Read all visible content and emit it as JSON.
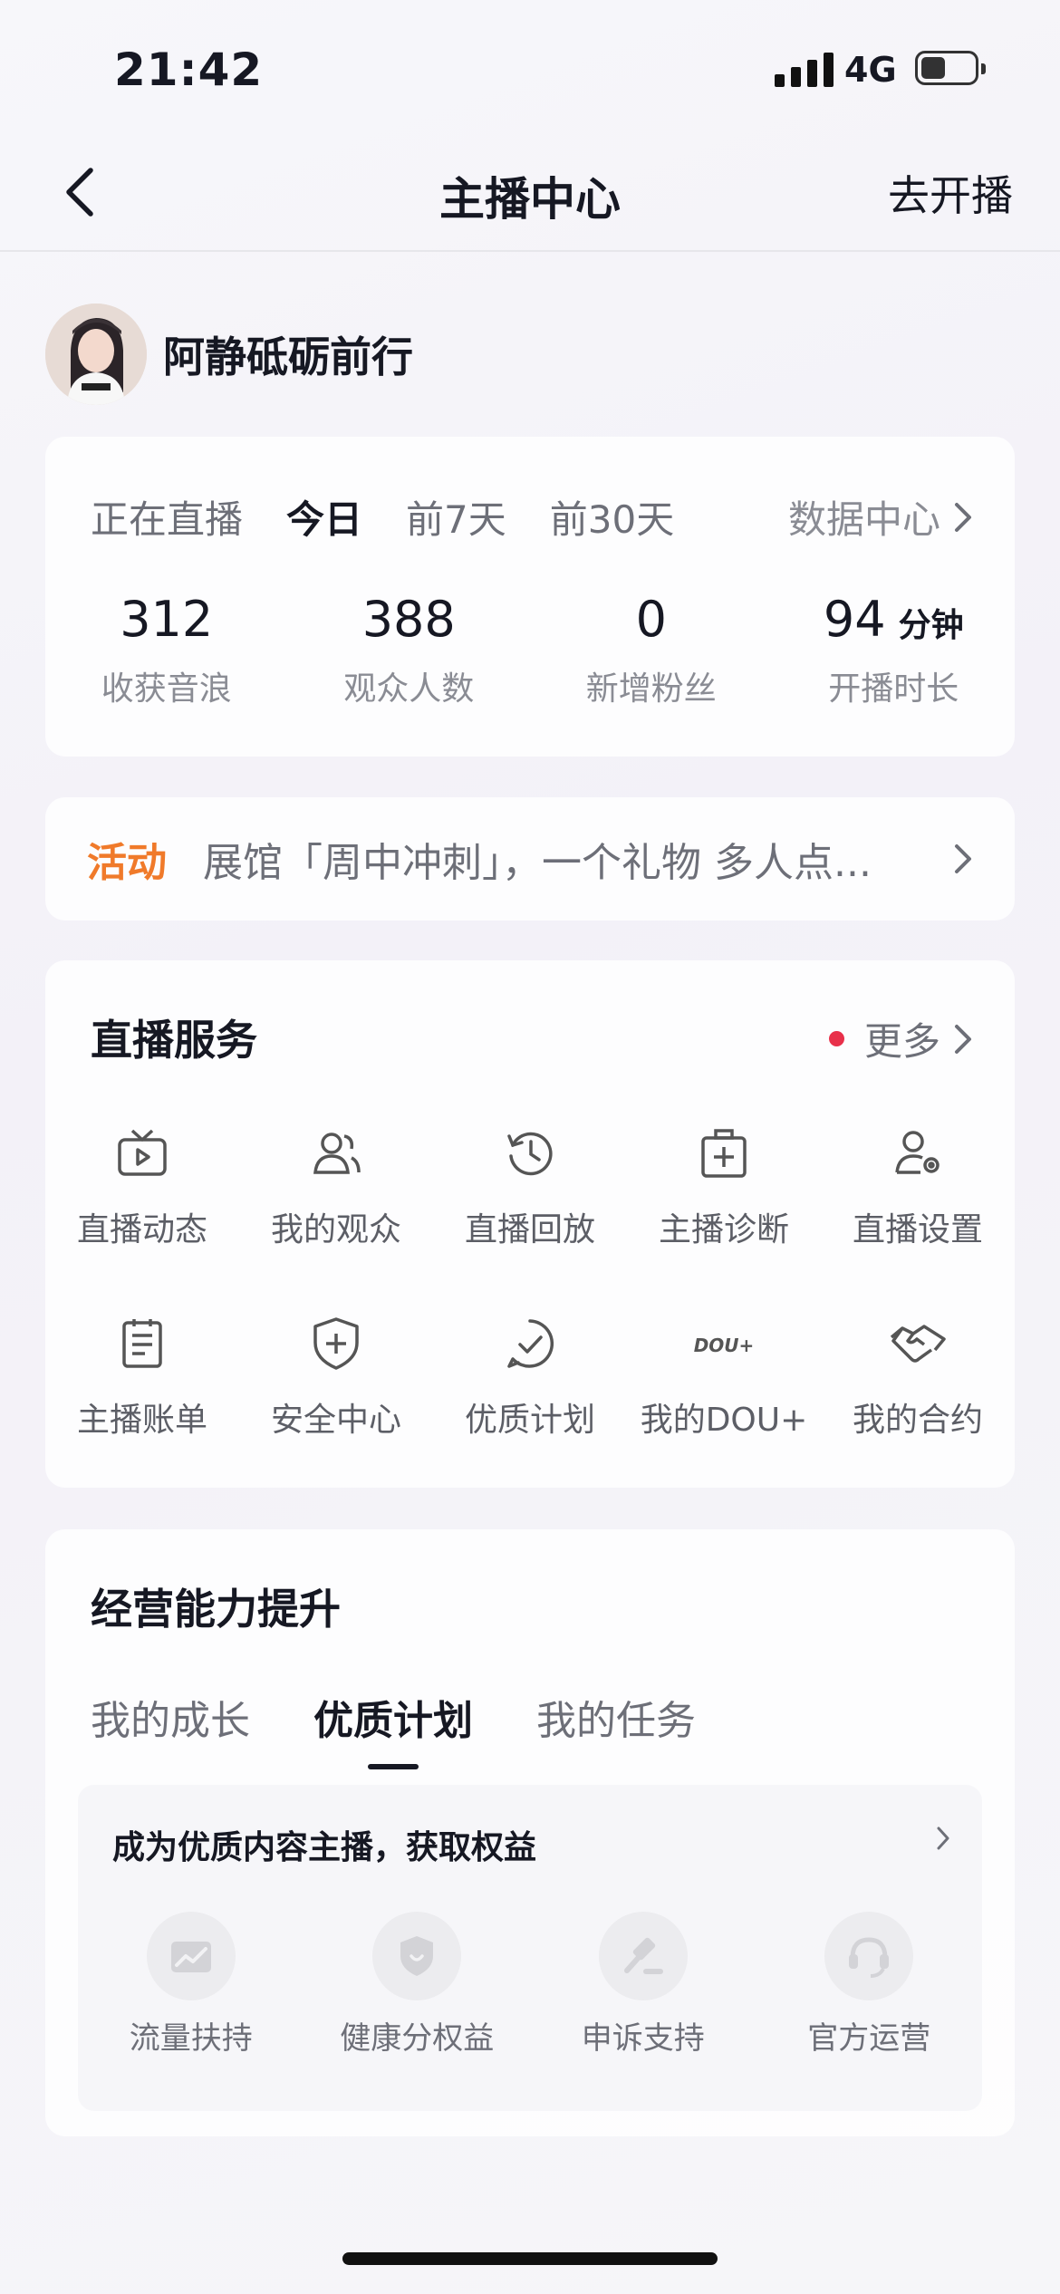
{
  "status_bar": {
    "time": "21:42",
    "network": "4G"
  },
  "nav": {
    "title": "主播中心",
    "action": "去开播"
  },
  "user": {
    "name": "阿静砥砺前行"
  },
  "stats_card": {
    "tabs": [
      "正在直播",
      "今日",
      "前7天",
      "前30天"
    ],
    "active_tab": "今日",
    "data_center": "数据中心",
    "stats": [
      {
        "value": "312",
        "unit": "",
        "label": "收获音浪"
      },
      {
        "value": "388",
        "unit": "",
        "label": "观众人数"
      },
      {
        "value": "0",
        "unit": "",
        "label": "新增粉丝"
      },
      {
        "value": "94",
        "unit": "分钟",
        "label": "开播时长"
      }
    ]
  },
  "activity": {
    "tag": "活动",
    "text": "展馆「周中冲刺」，一个礼物 多人点..."
  },
  "live_services": {
    "title": "直播服务",
    "more": "更多",
    "items": [
      {
        "label": "直播动态",
        "icon": "tv-icon"
      },
      {
        "label": "我的观众",
        "icon": "users-icon"
      },
      {
        "label": "直播回放",
        "icon": "replay-clock-icon"
      },
      {
        "label": "主播诊断",
        "icon": "medical-kit-icon"
      },
      {
        "label": "直播设置",
        "icon": "user-settings-icon"
      },
      {
        "label": "主播账单",
        "icon": "bill-icon"
      },
      {
        "label": "安全中心",
        "icon": "shield-plus-icon"
      },
      {
        "label": "优质计划",
        "icon": "check-bubble-icon"
      },
      {
        "label": "我的DOU+",
        "icon": "dou-plus-icon"
      },
      {
        "label": "我的合约",
        "icon": "handshake-icon"
      }
    ]
  },
  "business": {
    "title": "经营能力提升",
    "tabs": [
      "我的成长",
      "优质计划",
      "我的任务"
    ],
    "active_tab": "优质计划",
    "panel_title": "成为优质内容主播，获取权益",
    "benefits": [
      {
        "label": "流量扶持",
        "icon": "traffic-chart-icon"
      },
      {
        "label": "健康分权益",
        "icon": "shield-icon"
      },
      {
        "label": "申诉支持",
        "icon": "gavel-icon"
      },
      {
        "label": "官方运营",
        "icon": "headset-icon"
      }
    ]
  },
  "colors": {
    "accent_orange": "#f07a2a",
    "dot_red": "#e8304a",
    "text_primary": "#161823",
    "text_secondary": "#8a8c94"
  }
}
